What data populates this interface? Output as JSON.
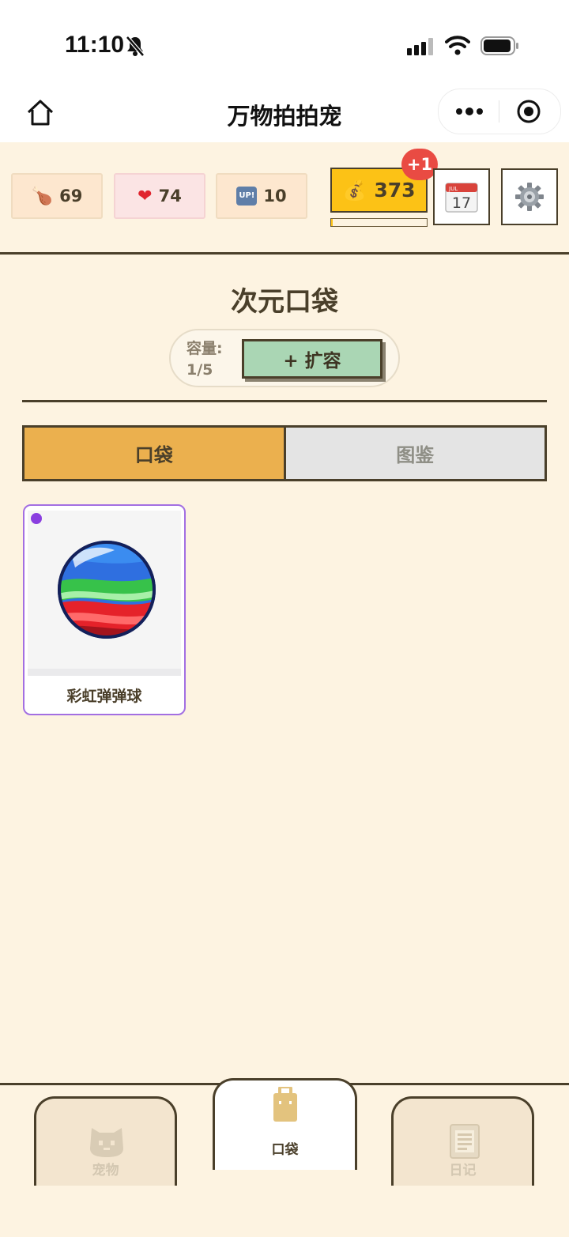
{
  "status_bar": {
    "time": "11:10"
  },
  "nav": {
    "title": "万物拍拍宠"
  },
  "stats": {
    "food": "69",
    "heart": "74",
    "up": "10",
    "up_badge": "UP!"
  },
  "coins": {
    "value": "373",
    "badge": "+1",
    "progress": 0.02
  },
  "calendar": {
    "month": "JUL",
    "day": "17"
  },
  "pocket": {
    "title": "次元口袋",
    "capacity_label": "容量:",
    "capacity_value": "1/5",
    "expand_label": "+ 扩容"
  },
  "tabs": {
    "pocket": "口袋",
    "collection": "图鉴"
  },
  "items": [
    {
      "name": "彩虹弹弹球",
      "rarity_color": "#8a3fe0"
    }
  ],
  "bottom_tabs": {
    "pet": "宠物",
    "pocket": "口袋",
    "diary": "日记"
  },
  "colors": {
    "background": "#fdf3e1",
    "border": "#4a3f2a",
    "active_tab": "#ebb04e",
    "coin": "#fcc216",
    "expand_button": "#aad6b4",
    "badge": "#e94b43"
  }
}
